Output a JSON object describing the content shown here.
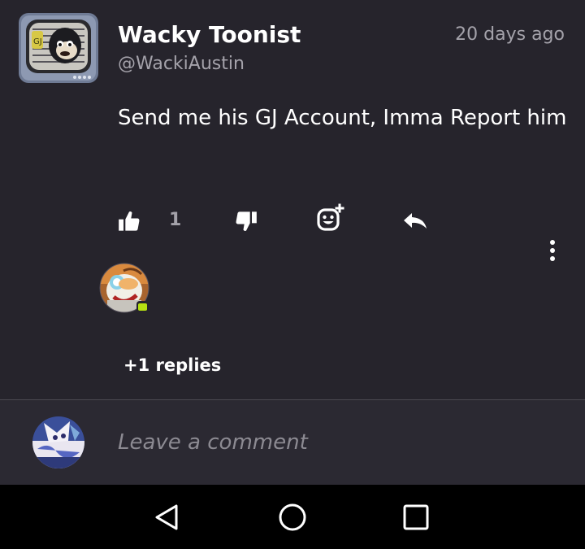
{
  "comment": {
    "author_name": "Wacky Toonist",
    "author_handle": "@WackiAustin",
    "timestamp": "20 days ago",
    "body": "Send me his GJ Account, Imma Report him",
    "like_count": "1",
    "replies_label": "+1 replies",
    "avatar_icon": "cartoon-tv-avatar",
    "replier_avatar_icon": "cartoon-character-avatar"
  },
  "actions": {
    "like_icon": "thumbs-up-icon",
    "dislike_icon": "thumbs-down-icon",
    "react_icon": "add-reaction-icon",
    "reply_icon": "reply-arrow-icon",
    "more_icon": "vertical-dots-icon"
  },
  "compose": {
    "placeholder": "Leave a comment",
    "avatar_icon": "user-avatar"
  },
  "navbar": {
    "back_icon": "triangle-back-icon",
    "home_icon": "circle-home-icon",
    "recents_icon": "square-recents-icon"
  },
  "colors": {
    "background": "#26242c",
    "compose_background": "#2b2932",
    "secondary_text": "#a4a2aa",
    "chat_badge": "#b6e012",
    "navbar": "#000000"
  }
}
